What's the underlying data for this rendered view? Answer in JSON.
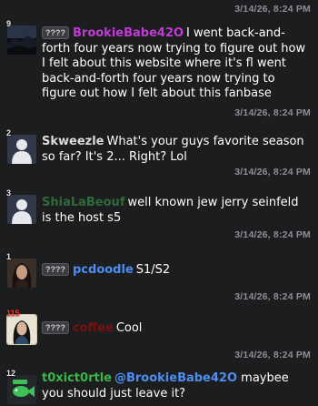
{
  "messages": [
    {
      "level": "9",
      "badge": "????",
      "username": "BrookieBabe42O",
      "user_color": "#c239d6",
      "text": "I went back-and-forth four years now trying to figure out how I felt about this website where it's fl went back-and-forth four years now trying to figure out how I felt about this fanbase",
      "timestamp": "3/14/26, 8:24 PM"
    },
    {
      "level": "2",
      "username": "Skweezle",
      "user_color": "#dcdcdc",
      "text": "What's your guys favorite season so far? It's 2... Right? Lol",
      "timestamp": "3/14/26, 8:24 PM"
    },
    {
      "level": "3",
      "username": "ShiaLaBeouf",
      "user_color": "#2e6b3c",
      "text": "well known jew jerry seinfeld is the host s5",
      "timestamp": "3/14/26, 8:24 PM"
    },
    {
      "level": "1",
      "badge": "????",
      "username": "pcdoodle",
      "user_color": "#4d8ef0",
      "text": "S1/S2",
      "timestamp": "3/14/26, 8:24 PM"
    },
    {
      "level": "115",
      "badge": "????",
      "username": "coffee",
      "user_color": "#7a1010",
      "text": "Cool",
      "timestamp": "3/14/26, 8:24 PM"
    },
    {
      "level": "12",
      "username": "t0xict0rtle",
      "user_color": "#39b54a",
      "mention": "@BrookieBabe42O",
      "text": "maybee you should just leave it?"
    }
  ],
  "top_timestamp": "3/14/26, 8:24 PM",
  "icons": {
    "avatar_1": "dark-landscape-avatar",
    "avatar_2": "default-person-avatar",
    "avatar_3": "default-person-avatar",
    "avatar_4": "photo-portrait-avatar",
    "avatar_5": "photo-portrait-avatar",
    "avatar_6": "fish-logo-avatar"
  }
}
